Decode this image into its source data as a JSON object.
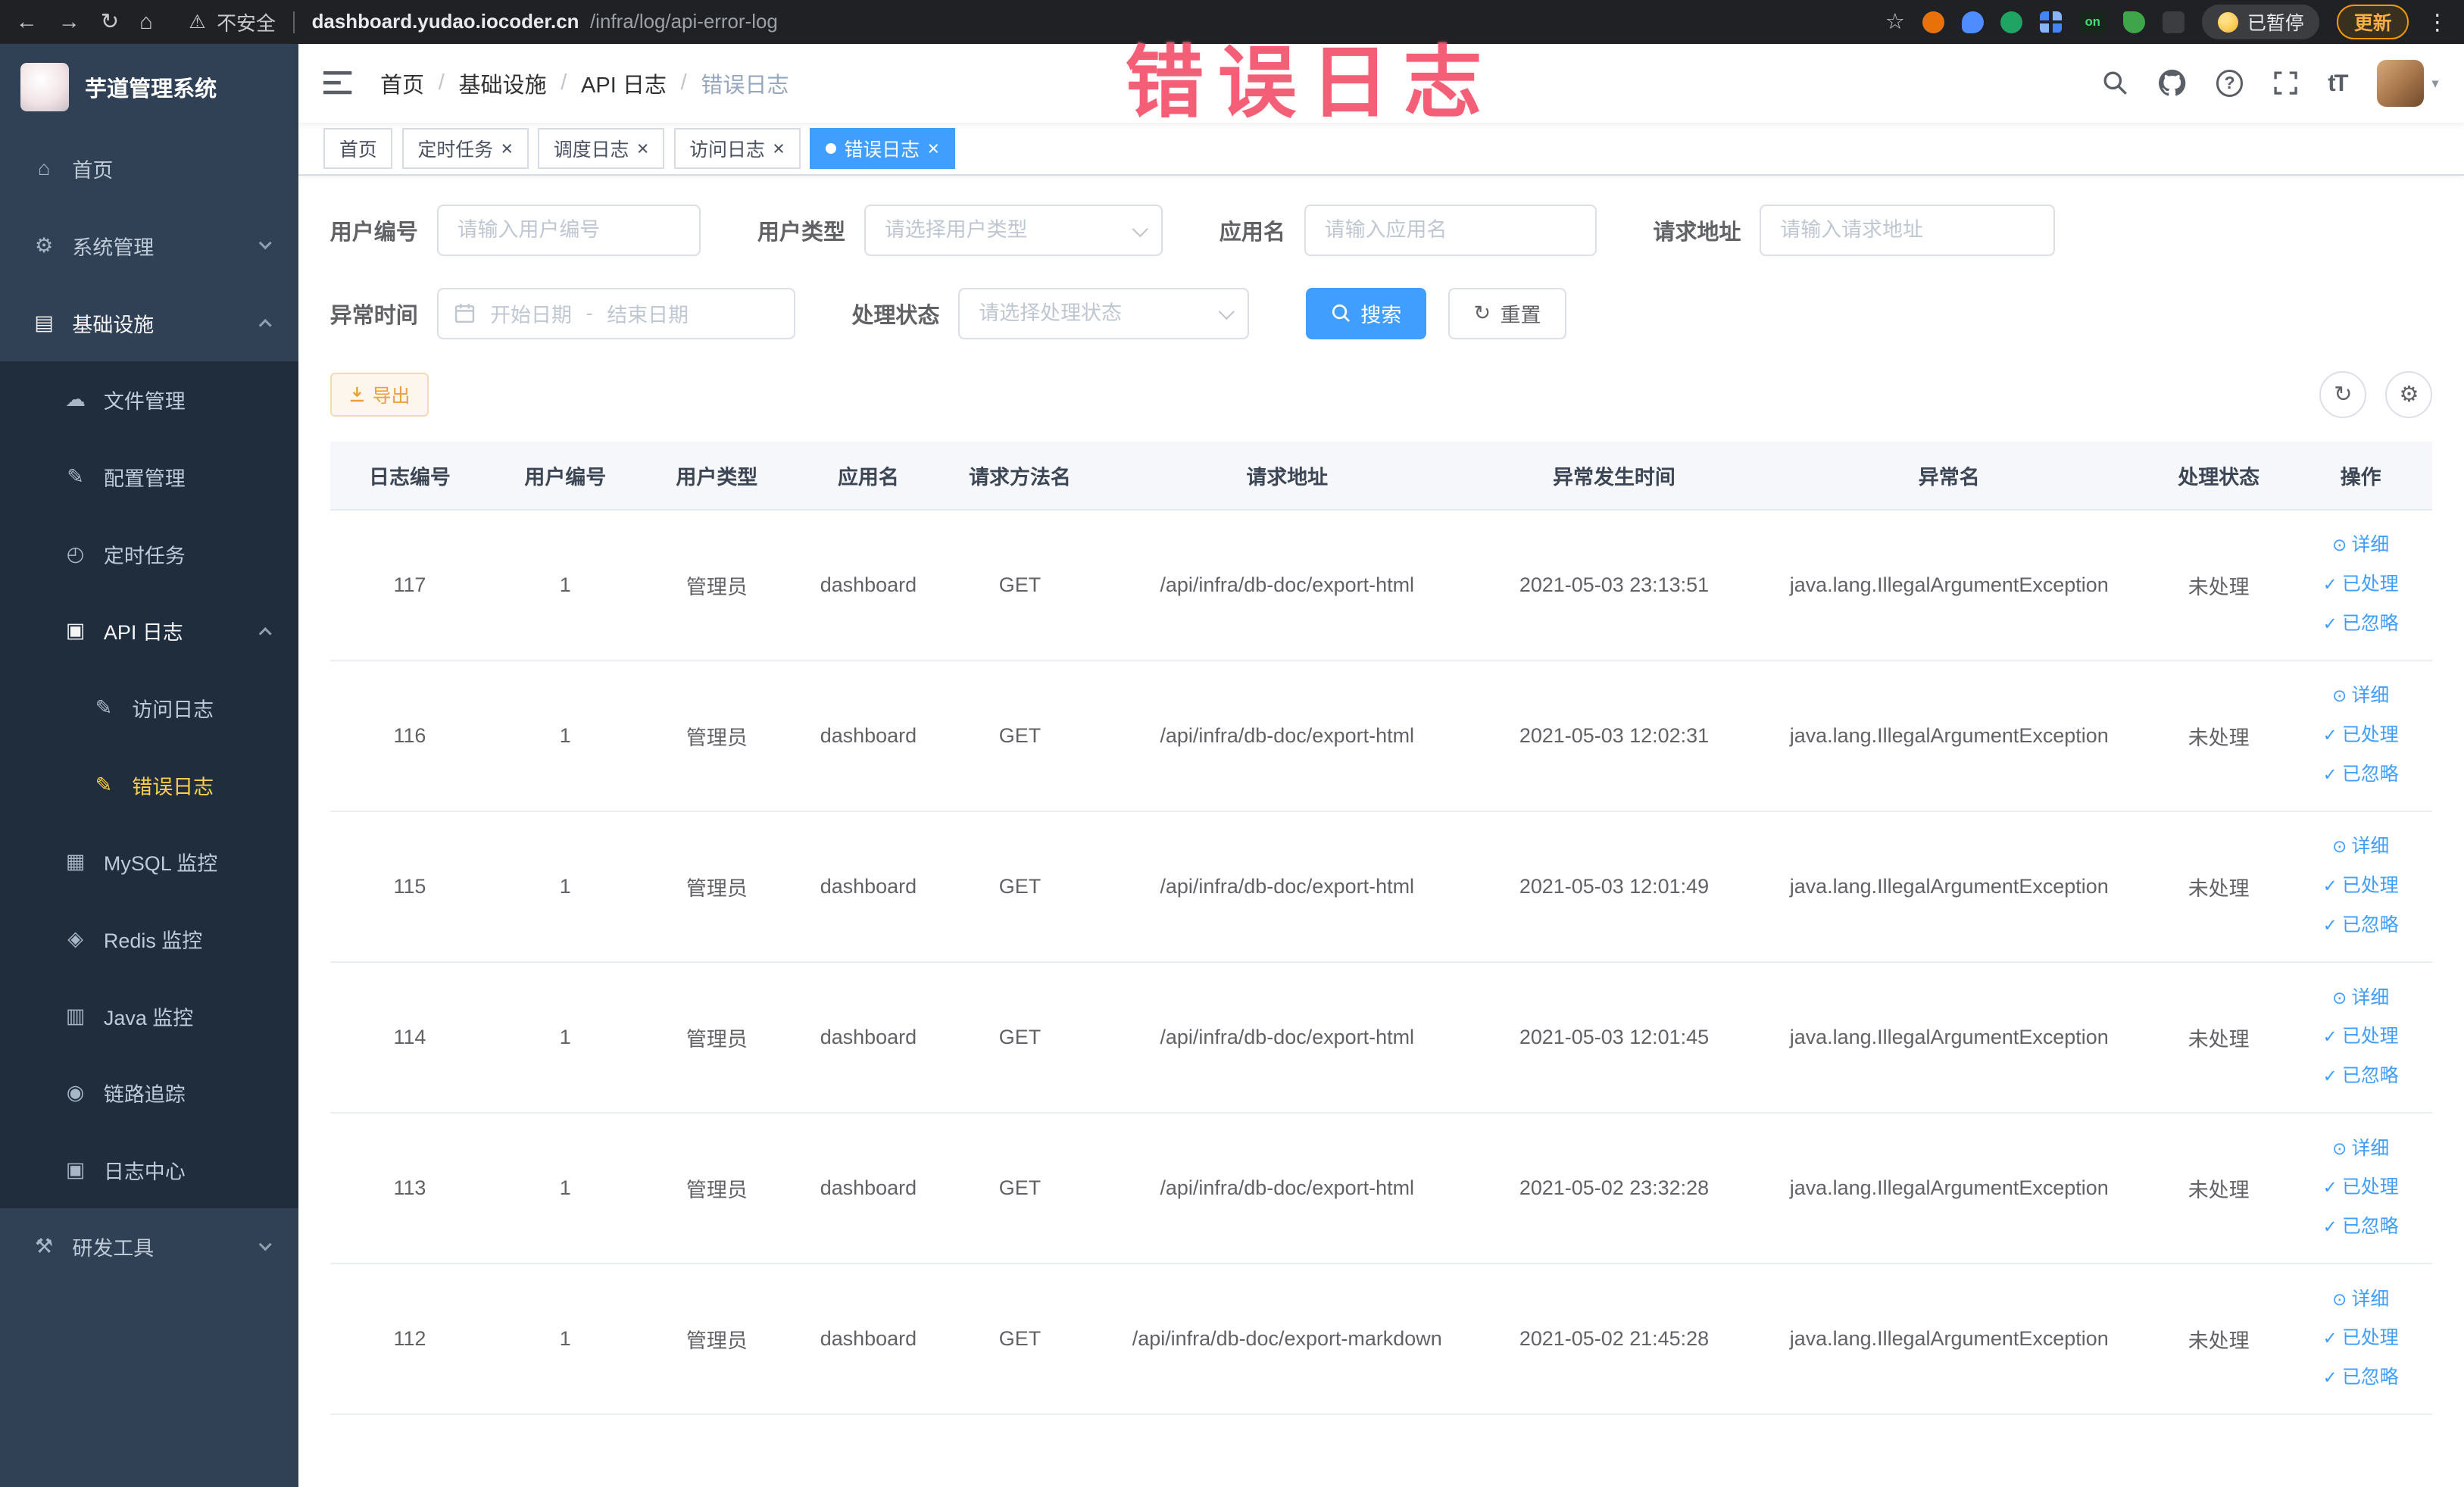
{
  "annotation": {
    "text": "错误日志"
  },
  "browser": {
    "security_label": "不安全",
    "url_host": "dashboard.yudao.iocoder.cn",
    "url_path": "/infra/log/api-error-log",
    "on_badge": "on",
    "paused_label": "已暂停",
    "update_label": "更新"
  },
  "icons": {
    "back": "←",
    "forward": "→",
    "reload": "↻",
    "home": "⌂",
    "warning": "⚠",
    "star": "☆",
    "dots": "⋮",
    "close": "×",
    "question": "?",
    "caret": "▾",
    "gear": "⚙",
    "infra": "▤",
    "file": "☁",
    "config": "✎",
    "job": "◴",
    "api": "▣",
    "log_edit": "✎",
    "mysql": "▦",
    "redis": "◈",
    "java": "▥",
    "trace": "◉",
    "log_center": "▣",
    "dev": "⚒",
    "eye": "⊙",
    "check": "✓",
    "reset": "↻",
    "refresh": "↻",
    "settings": "⚙"
  },
  "sidebar": {
    "logo_title": "芋道管理系统",
    "menu": {
      "home": "首页",
      "system": "系统管理",
      "infra": "基础设施",
      "file": "文件管理",
      "config": "配置管理",
      "job": "定时任务",
      "api_log": "API 日志",
      "access_log": "访问日志",
      "error_log": "错误日志",
      "mysql": "MySQL 监控",
      "redis": "Redis 监控",
      "java": "Java 监控",
      "trace": "链路追踪",
      "log_center": "日志中心",
      "dev": "研发工具"
    }
  },
  "navbar": {
    "breadcrumb": [
      "首页",
      "基础设施",
      "API 日志",
      "错误日志"
    ],
    "breadcrumb_separator": "/",
    "font_size_icon_text": "tT"
  },
  "tabs": [
    {
      "label": "首页"
    },
    {
      "label": "定时任务"
    },
    {
      "label": "调度日志"
    },
    {
      "label": "访问日志"
    },
    {
      "label": "错误日志"
    }
  ],
  "filters": {
    "user_id_label": "用户编号",
    "user_id_placeholder": "请输入用户编号",
    "user_type_label": "用户类型",
    "user_type_placeholder": "请选择用户类型",
    "app_name_label": "应用名",
    "app_name_placeholder": "请输入应用名",
    "request_url_label": "请求地址",
    "request_url_placeholder": "请输入请求地址",
    "exception_time_label": "异常时间",
    "date_start_placeholder": "开始日期",
    "date_separator": "-",
    "date_end_placeholder": "结束日期",
    "process_status_label": "处理状态",
    "process_status_placeholder": "请选择处理状态",
    "search_label": "搜索",
    "reset_label": "重置"
  },
  "toolbar": {
    "export_label": "导出"
  },
  "table": {
    "columns": [
      "日志编号",
      "用户编号",
      "用户类型",
      "应用名",
      "请求方法名",
      "请求地址",
      "异常发生时间",
      "异常名",
      "处理状态",
      "操作"
    ],
    "actions": [
      "详细",
      "已处理",
      "已忽略"
    ],
    "rows": [
      {
        "id": "117",
        "user_id": "1",
        "user_type": "管理员",
        "app": "dashboard",
        "method": "GET",
        "url": "/api/infra/db-doc/export-html",
        "time": "2021-05-03 23:13:51",
        "exception": "java.lang.IllegalArgumentException",
        "status": "未处理"
      },
      {
        "id": "116",
        "user_id": "1",
        "user_type": "管理员",
        "app": "dashboard",
        "method": "GET",
        "url": "/api/infra/db-doc/export-html",
        "time": "2021-05-03 12:02:31",
        "exception": "java.lang.IllegalArgumentException",
        "status": "未处理"
      },
      {
        "id": "115",
        "user_id": "1",
        "user_type": "管理员",
        "app": "dashboard",
        "method": "GET",
        "url": "/api/infra/db-doc/export-html",
        "time": "2021-05-03 12:01:49",
        "exception": "java.lang.IllegalArgumentException",
        "status": "未处理"
      },
      {
        "id": "114",
        "user_id": "1",
        "user_type": "管理员",
        "app": "dashboard",
        "method": "GET",
        "url": "/api/infra/db-doc/export-html",
        "time": "2021-05-03 12:01:45",
        "exception": "java.lang.IllegalArgumentException",
        "status": "未处理"
      },
      {
        "id": "113",
        "user_id": "1",
        "user_type": "管理员",
        "app": "dashboard",
        "method": "GET",
        "url": "/api/infra/db-doc/export-html",
        "time": "2021-05-02 23:32:28",
        "exception": "java.lang.IllegalArgumentException",
        "status": "未处理"
      },
      {
        "id": "112",
        "user_id": "1",
        "user_type": "管理员",
        "app": "dashboard",
        "method": "GET",
        "url": "/api/infra/db-doc/export-markdown",
        "time": "2021-05-02 21:45:28",
        "exception": "java.lang.IllegalArgumentException",
        "status": "未处理"
      }
    ]
  },
  "colors": {
    "primary": "#409eff",
    "sidebar_bg": "#304156",
    "submenu_bg": "#1f2d3d",
    "active_menu_text": "#ffd04b",
    "warning": "#e6a23c",
    "annotation": "#f4516c"
  }
}
